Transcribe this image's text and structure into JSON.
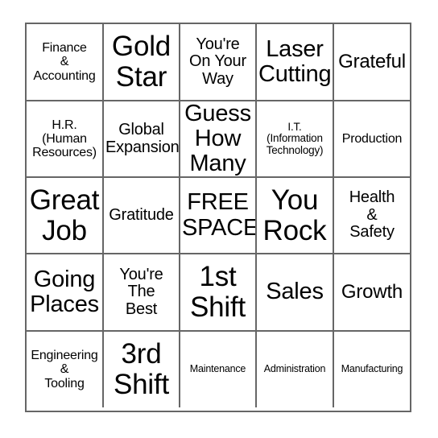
{
  "card": {
    "rows": 5,
    "columns": 5,
    "border_color": "#666666",
    "background_color": "#ffffff",
    "text_color": "#000000",
    "cells": [
      {
        "text": "Finance\n&\nAccounting",
        "size": "sm"
      },
      {
        "text": "Gold\nStar",
        "size": "xxl"
      },
      {
        "text": "You're\nOn Your\nWay",
        "size": "md"
      },
      {
        "text": "Laser\nCutting",
        "size": "xl"
      },
      {
        "text": "Grateful",
        "size": "lg"
      },
      {
        "text": "H.R.\n(Human\nResources)",
        "size": "sm"
      },
      {
        "text": "Global\nExpansion",
        "size": "md"
      },
      {
        "text": "Guess\nHow\nMany",
        "size": "xl"
      },
      {
        "text": "I.T.\n(Information\nTechnology)",
        "size": "xs"
      },
      {
        "text": "Production",
        "size": "sm"
      },
      {
        "text": "Great\nJob",
        "size": "xxl"
      },
      {
        "text": "Gratitude",
        "size": "md"
      },
      {
        "text": "FREE\nSPACE",
        "size": "xl"
      },
      {
        "text": "You\nRock",
        "size": "xxl"
      },
      {
        "text": "Health\n&\nSafety",
        "size": "md"
      },
      {
        "text": "Going\nPlaces",
        "size": "xl"
      },
      {
        "text": "You're\nThe\nBest",
        "size": "md"
      },
      {
        "text": "1st\nShift",
        "size": "xxl"
      },
      {
        "text": "Sales",
        "size": "xl"
      },
      {
        "text": "Growth",
        "size": "lg"
      },
      {
        "text": "Engineering\n&\nTooling",
        "size": "sm"
      },
      {
        "text": "3rd\nShift",
        "size": "xxl"
      },
      {
        "text": "Maintenance",
        "size": "xxs"
      },
      {
        "text": "Administration",
        "size": "xxs"
      },
      {
        "text": "Manufacturing",
        "size": "xxs"
      }
    ]
  }
}
